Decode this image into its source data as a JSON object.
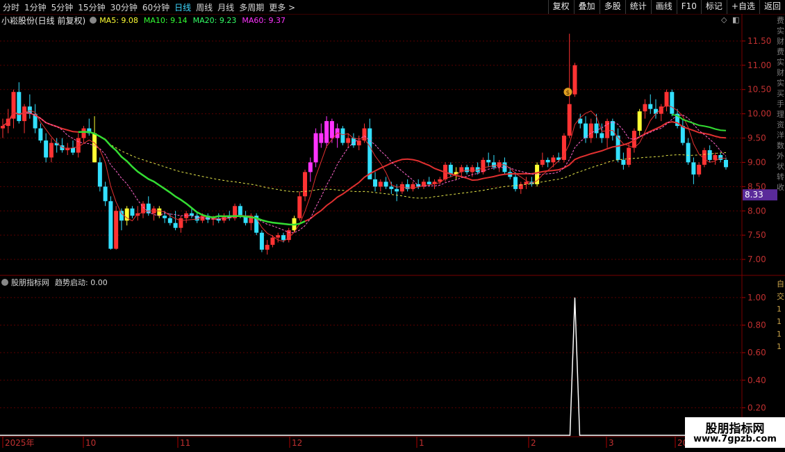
{
  "toolbar": {
    "tabs": [
      {
        "label": "分时",
        "active": false
      },
      {
        "label": "1分钟",
        "active": false
      },
      {
        "label": "5分钟",
        "active": false
      },
      {
        "label": "15分钟",
        "active": false
      },
      {
        "label": "30分钟",
        "active": false
      },
      {
        "label": "60分钟",
        "active": false
      },
      {
        "label": "日线",
        "active": true
      },
      {
        "label": "周线",
        "active": false
      },
      {
        "label": "月线",
        "active": false
      },
      {
        "label": "多周期",
        "active": false
      },
      {
        "label": "更多 >",
        "active": false
      }
    ],
    "right_buttons": [
      "复权",
      "叠加",
      "多股",
      "统计",
      "画线",
      "F10",
      "标记",
      "+自选",
      "返回"
    ]
  },
  "info": {
    "stock": "小崧股份(日线 前复权)",
    "ma5": "MA5: 9.08",
    "ma10": "MA10: 9.14",
    "ma20": "MA20: 9.23",
    "ma60": "MA60: 9.37",
    "colors": {
      "ma5": "#ffff33",
      "ma10": "#33ff33",
      "ma20": "#33ff66",
      "ma60": "#ff33ff"
    }
  },
  "main_axis": {
    "ticks": [
      "11.50",
      "11.00",
      "10.50",
      "10.00",
      "9.50",
      "9.00",
      "8.50",
      "8.00",
      "7.50",
      "7.00"
    ],
    "price_label": "8.33"
  },
  "sub": {
    "title": "股朋指标网",
    "indicator": "趋势启动: 0.00",
    "ticks": [
      "1.00",
      "0.80",
      "0.60",
      "0.40",
      "0.20"
    ]
  },
  "date_axis": [
    "2025年",
    "10",
    "11",
    "12",
    "1",
    "2",
    "3",
    "20"
  ],
  "watermark": {
    "line1": "股朋指标网",
    "line2": "www.7gpzb.com"
  },
  "right_side_text": "费实财费实财实买手理资洋数外状转收",
  "right_side_text2": "自交1111",
  "chart_data": {
    "type": "candlestick",
    "ylim": [
      6.7,
      11.8
    ],
    "ticks": [
      11.5,
      11.0,
      10.5,
      10.0,
      9.5,
      9.0,
      8.5,
      8.0,
      7.5,
      7.0
    ],
    "candles": [
      [
        9.7,
        9.9,
        9.5,
        9.75
      ],
      [
        9.75,
        10.1,
        9.6,
        9.9
      ],
      [
        9.9,
        10.5,
        9.7,
        10.45
      ],
      [
        10.45,
        10.65,
        9.8,
        9.85
      ],
      [
        9.85,
        10.2,
        9.6,
        10.15
      ],
      [
        10.15,
        10.4,
        9.9,
        10.0
      ],
      [
        10.0,
        10.2,
        9.6,
        9.7
      ],
      [
        9.7,
        9.8,
        9.4,
        9.45
      ],
      [
        9.45,
        9.6,
        9.0,
        9.1
      ],
      [
        9.1,
        9.5,
        9.0,
        9.4
      ],
      [
        9.4,
        9.5,
        9.2,
        9.35
      ],
      [
        9.35,
        9.5,
        9.2,
        9.25
      ],
      [
        9.25,
        9.4,
        9.15,
        9.3
      ],
      [
        9.3,
        9.45,
        9.15,
        9.2
      ],
      [
        9.2,
        9.6,
        9.1,
        9.5
      ],
      [
        9.5,
        9.75,
        9.4,
        9.7
      ],
      [
        9.7,
        9.9,
        9.55,
        9.6
      ],
      [
        9.6,
        9.95,
        9.05,
        9.0
      ],
      [
        9.0,
        9.1,
        8.4,
        8.5
      ],
      [
        8.5,
        8.6,
        8.1,
        8.2
      ],
      [
        8.2,
        8.3,
        7.2,
        7.22
      ],
      [
        7.22,
        8.1,
        7.2,
        8.0
      ],
      [
        8.0,
        8.05,
        7.6,
        7.8
      ],
      [
        7.8,
        8.1,
        7.7,
        8.05
      ],
      [
        8.05,
        8.1,
        7.85,
        7.9
      ],
      [
        7.9,
        8.1,
        7.8,
        7.95
      ],
      [
        7.95,
        8.2,
        7.85,
        8.15
      ],
      [
        8.15,
        8.3,
        7.9,
        7.95
      ],
      [
        7.95,
        8.1,
        7.8,
        8.05
      ],
      [
        8.05,
        8.1,
        7.85,
        7.9
      ],
      [
        7.9,
        8.0,
        7.75,
        7.85
      ],
      [
        7.85,
        7.95,
        7.7,
        7.75
      ],
      [
        7.75,
        8.0,
        7.6,
        7.65
      ],
      [
        7.65,
        7.9,
        7.55,
        7.85
      ],
      [
        7.85,
        8.0,
        7.75,
        7.95
      ],
      [
        7.95,
        8.05,
        7.85,
        7.9
      ],
      [
        7.9,
        7.95,
        7.75,
        7.8
      ],
      [
        7.8,
        7.95,
        7.75,
        7.9
      ],
      [
        7.9,
        7.95,
        7.75,
        7.82
      ],
      [
        7.82,
        7.9,
        7.7,
        7.85
      ],
      [
        7.85,
        7.95,
        7.75,
        7.8
      ],
      [
        7.8,
        7.95,
        7.75,
        7.9
      ],
      [
        7.9,
        8.0,
        7.8,
        7.85
      ],
      [
        7.85,
        8.15,
        7.8,
        8.1
      ],
      [
        8.1,
        8.15,
        7.85,
        7.9
      ],
      [
        7.9,
        8.0,
        7.7,
        7.75
      ],
      [
        7.75,
        7.95,
        7.6,
        7.9
      ],
      [
        7.9,
        7.95,
        7.5,
        7.55
      ],
      [
        7.55,
        7.6,
        7.15,
        7.2
      ],
      [
        7.2,
        7.4,
        7.1,
        7.3
      ],
      [
        7.3,
        7.5,
        7.25,
        7.45
      ],
      [
        7.45,
        7.55,
        7.35,
        7.5
      ],
      [
        7.5,
        7.55,
        7.35,
        7.4
      ],
      [
        7.4,
        7.65,
        7.35,
        7.6
      ],
      [
        7.6,
        7.9,
        7.55,
        7.85
      ],
      [
        7.85,
        8.4,
        7.8,
        8.3
      ],
      [
        8.3,
        8.85,
        8.2,
        8.8
      ],
      [
        8.8,
        9.1,
        8.6,
        9.0
      ],
      [
        9.0,
        9.7,
        8.9,
        9.6
      ],
      [
        9.6,
        9.8,
        9.3,
        9.4
      ],
      [
        9.4,
        9.95,
        9.3,
        9.85
      ],
      [
        9.85,
        9.9,
        9.4,
        9.5
      ],
      [
        9.5,
        9.8,
        9.3,
        9.7
      ],
      [
        9.7,
        9.75,
        9.35,
        9.4
      ],
      [
        9.4,
        9.6,
        9.3,
        9.5
      ],
      [
        9.5,
        9.6,
        9.3,
        9.35
      ],
      [
        9.35,
        9.55,
        9.25,
        9.45
      ],
      [
        9.45,
        9.8,
        9.4,
        9.7
      ],
      [
        9.7,
        9.9,
        8.9,
        8.65
      ],
      [
        8.65,
        8.8,
        8.4,
        8.5
      ],
      [
        8.5,
        8.65,
        8.4,
        8.6
      ],
      [
        8.6,
        8.7,
        8.45,
        8.5
      ],
      [
        8.5,
        8.6,
        8.35,
        8.45
      ],
      [
        8.45,
        8.55,
        8.2,
        8.4
      ],
      [
        8.4,
        8.6,
        8.35,
        8.55
      ],
      [
        8.55,
        8.65,
        8.4,
        8.45
      ],
      [
        8.45,
        8.6,
        8.4,
        8.55
      ],
      [
        8.55,
        8.65,
        8.45,
        8.5
      ],
      [
        8.5,
        8.65,
        8.45,
        8.6
      ],
      [
        8.6,
        8.7,
        8.5,
        8.55
      ],
      [
        8.55,
        8.65,
        8.45,
        8.6
      ],
      [
        8.6,
        8.7,
        8.55,
        8.65
      ],
      [
        8.65,
        9.0,
        8.6,
        8.95
      ],
      [
        8.95,
        9.0,
        8.7,
        8.75
      ],
      [
        8.75,
        8.9,
        8.65,
        8.8
      ],
      [
        8.8,
        8.95,
        8.7,
        8.9
      ],
      [
        8.9,
        8.95,
        8.75,
        8.8
      ],
      [
        8.8,
        8.95,
        8.7,
        8.9
      ],
      [
        8.9,
        9.0,
        8.75,
        8.8
      ],
      [
        8.8,
        9.1,
        8.75,
        9.05
      ],
      [
        9.05,
        9.2,
        8.9,
        9.0
      ],
      [
        9.0,
        9.15,
        8.85,
        8.9
      ],
      [
        8.9,
        9.05,
        8.8,
        9.0
      ],
      [
        9.0,
        9.1,
        8.75,
        8.8
      ],
      [
        8.8,
        8.9,
        8.65,
        8.7
      ],
      [
        8.7,
        8.8,
        8.4,
        8.45
      ],
      [
        8.45,
        8.6,
        8.35,
        8.55
      ],
      [
        8.55,
        8.7,
        8.45,
        8.6
      ],
      [
        8.6,
        8.7,
        8.5,
        8.55
      ],
      [
        8.55,
        9.0,
        8.5,
        8.95
      ],
      [
        8.95,
        9.2,
        8.9,
        9.05
      ],
      [
        9.05,
        9.1,
        8.9,
        9.0
      ],
      [
        9.0,
        9.15,
        8.9,
        9.1
      ],
      [
        9.1,
        9.2,
        9.0,
        9.05
      ],
      [
        9.05,
        9.6,
        9.0,
        9.55
      ],
      [
        9.55,
        11.65,
        9.5,
        10.2
      ],
      [
        10.4,
        11.05,
        10.35,
        11.0
      ],
      [
        9.9,
        10.0,
        9.7,
        9.8
      ],
      [
        9.8,
        9.95,
        9.4,
        9.5
      ],
      [
        9.5,
        9.9,
        9.4,
        9.8
      ],
      [
        9.8,
        10.0,
        9.5,
        9.6
      ],
      [
        9.6,
        9.8,
        9.4,
        9.5
      ],
      [
        9.5,
        9.9,
        9.3,
        9.85
      ],
      [
        9.85,
        9.9,
        9.45,
        9.55
      ],
      [
        9.55,
        9.7,
        9.0,
        9.05
      ],
      [
        9.05,
        9.2,
        8.85,
        8.95
      ],
      [
        8.95,
        9.4,
        8.9,
        9.3
      ],
      [
        9.3,
        9.7,
        9.2,
        9.65
      ],
      [
        9.65,
        10.1,
        9.55,
        10.05
      ],
      [
        10.05,
        10.3,
        9.9,
        10.2
      ],
      [
        10.2,
        10.4,
        10.0,
        10.1
      ],
      [
        10.1,
        10.3,
        9.9,
        10.0
      ],
      [
        10.0,
        10.2,
        9.85,
        10.15
      ],
      [
        10.15,
        10.5,
        10.05,
        10.45
      ],
      [
        10.45,
        10.5,
        9.95,
        10.0
      ],
      [
        10.0,
        10.1,
        9.7,
        9.75
      ],
      [
        9.75,
        9.9,
        9.35,
        9.4
      ],
      [
        9.4,
        9.5,
        8.95,
        9.0
      ],
      [
        9.0,
        9.1,
        8.55,
        8.75
      ],
      [
        8.75,
        9.0,
        8.7,
        8.95
      ],
      [
        8.95,
        9.3,
        8.9,
        9.25
      ],
      [
        9.25,
        9.35,
        9.0,
        9.05
      ],
      [
        9.05,
        9.2,
        8.95,
        9.15
      ],
      [
        9.15,
        9.2,
        9.0,
        9.05
      ],
      [
        9.05,
        9.1,
        8.85,
        8.9
      ]
    ],
    "trend_signal": {
      "x_index": 106,
      "value": 1.0,
      "ylim": [
        0,
        1.05
      ]
    }
  }
}
